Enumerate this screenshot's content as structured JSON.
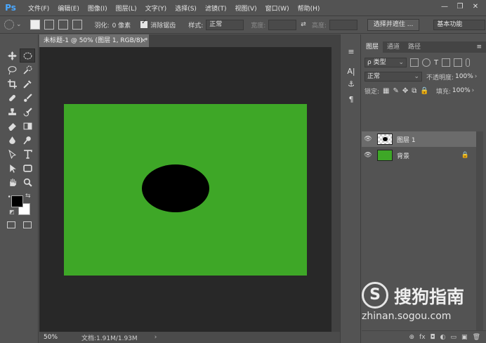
{
  "app": {
    "logo_text": "Ps"
  },
  "menu": [
    "文件(F)",
    "编辑(E)",
    "图像(I)",
    "图层(L)",
    "文字(Y)",
    "选择(S)",
    "滤镜(T)",
    "视图(V)",
    "窗口(W)",
    "帮助(H)"
  ],
  "window_controls": {
    "minimize": "—",
    "restore": "❐",
    "close": "✕"
  },
  "options": {
    "feather_label": "羽化:",
    "feather_value": "0 像素",
    "antialias_label": "消除锯齿",
    "style_label": "样式:",
    "style_value": "正常",
    "width_label": "宽度:",
    "height_label": "高度:",
    "swap_icon": "⇄",
    "select_mask_button": "选择并遮住 ...",
    "workspace_value": "基本功能"
  },
  "document": {
    "tab_title": "未标题-1 @ 50% (图层 1, RGB/8) *",
    "tab_close": "×",
    "canvas_color": "#3ea727",
    "ellipse_color": "#000000"
  },
  "status": {
    "zoom": "50%",
    "doc_info": "文档:1.91M/1.93M",
    "arrow": "›"
  },
  "side_strip": [
    "≡",
    "A|",
    "⚓",
    "¶"
  ],
  "layers_panel": {
    "tabs": [
      "图层",
      "通道",
      "路径"
    ],
    "active_tab": "图层",
    "menu_icon": "≡",
    "filter_label": "ρ 类型",
    "blend_mode": "正常",
    "opacity_label": "不透明度:",
    "opacity_value": "100%",
    "lock_label": "锁定:",
    "fill_label": "填充:",
    "fill_value": "100%",
    "layers": [
      {
        "name": "图层 1",
        "visible": true,
        "selected": true
      },
      {
        "name": "背景",
        "visible": true,
        "selected": false,
        "locked": true
      }
    ]
  },
  "footer_icons": [
    "⊕",
    "fx",
    "◘",
    "◐",
    "▭",
    "▣",
    "🗑"
  ],
  "watermark": {
    "logo_letter": "S",
    "name": "搜狗指南",
    "url": "zhinan.sogou.com"
  }
}
